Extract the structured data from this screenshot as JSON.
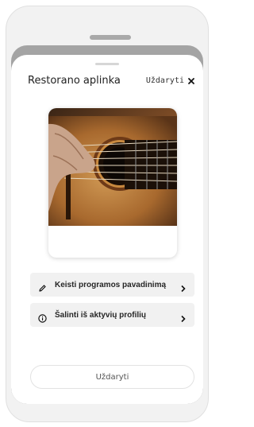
{
  "modal": {
    "title": "Restorano aplinka",
    "close_label": "Uždaryti",
    "image": "guitar-player-photo"
  },
  "actions": [
    {
      "label": "Keisti programos pavadinimą",
      "icon": "pencil-icon"
    },
    {
      "label": "Šalinti iš aktyvių profilių",
      "icon": "info-circle-icon"
    }
  ],
  "footer": {
    "close_button_label": "Uždaryti"
  },
  "colors": {
    "backdrop": "#a4a4a4",
    "sheet": "#ffffff",
    "item_bg": "#f1f1f1"
  }
}
